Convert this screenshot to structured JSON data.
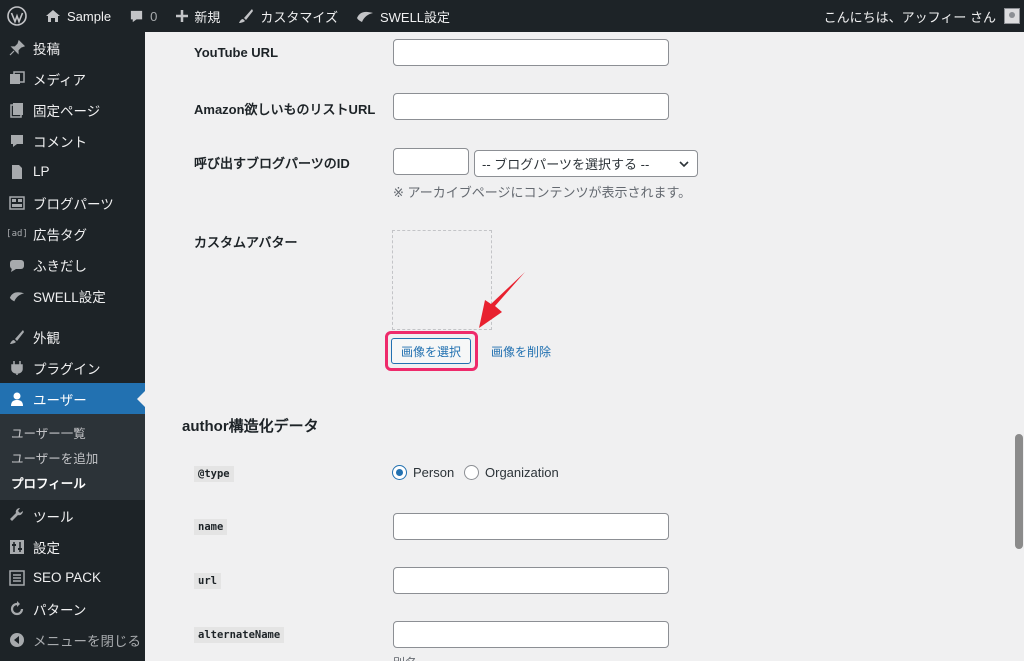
{
  "adminbar": {
    "site_name": "Sample",
    "comments_count": "0",
    "new_label": "新規",
    "customize_label": "カスタマイズ",
    "swell_label": "SWELL設定",
    "greeting": "こんにちは、アッフィー さん"
  },
  "sidebar": {
    "items": [
      {
        "label": "投稿",
        "icon": "pin-icon"
      },
      {
        "label": "メディア",
        "icon": "media-icon"
      },
      {
        "label": "固定ページ",
        "icon": "page-icon"
      },
      {
        "label": "コメント",
        "icon": "comment-icon"
      },
      {
        "label": "LP",
        "icon": "lp-icon"
      },
      {
        "label": "ブログパーツ",
        "icon": "blogparts-icon"
      },
      {
        "label": "広告タグ",
        "icon": "ad-icon"
      },
      {
        "label": "ふきだし",
        "icon": "balloon-icon"
      },
      {
        "label": "SWELL設定",
        "icon": "swell-icon"
      },
      {
        "label": "外観",
        "icon": "brush-icon"
      },
      {
        "label": "プラグイン",
        "icon": "plugin-icon"
      },
      {
        "label": "ユーザー",
        "icon": "user-icon"
      },
      {
        "label": "ツール",
        "icon": "wrench-icon"
      },
      {
        "label": "設定",
        "icon": "settings-icon"
      },
      {
        "label": "SEO PACK",
        "icon": "seo-icon"
      },
      {
        "label": "パターン",
        "icon": "pattern-icon"
      },
      {
        "label": "メニューを閉じる",
        "icon": "collapse-icon"
      }
    ],
    "submenu": [
      "ユーザー一覧",
      "ユーザーを追加",
      "プロフィール"
    ]
  },
  "form": {
    "youtube_label": "YouTube URL",
    "amazon_label": "Amazon欲しいものリストURL",
    "blogparts_label": "呼び出すブログパーツのID",
    "blogparts_select": "-- ブログパーツを選択する --",
    "blogparts_desc": "※ アーカイブページにコンテンツが表示されます。",
    "avatar_label": "カスタムアバター",
    "select_image": "画像を選択",
    "delete_image": "画像を削除"
  },
  "author": {
    "title": "author構造化データ",
    "type_label": "@type",
    "type_options": [
      "Person",
      "Organization"
    ],
    "type_selected": "Person",
    "name_label": "name",
    "url_label": "url",
    "alt_label": "alternateName",
    "alt_desc": "別名"
  },
  "colors": {
    "admin_dark": "#1d2327",
    "accent_blue": "#2271b1",
    "highlight_pink": "#ee2a6b",
    "arrow_red": "#e8212f"
  }
}
